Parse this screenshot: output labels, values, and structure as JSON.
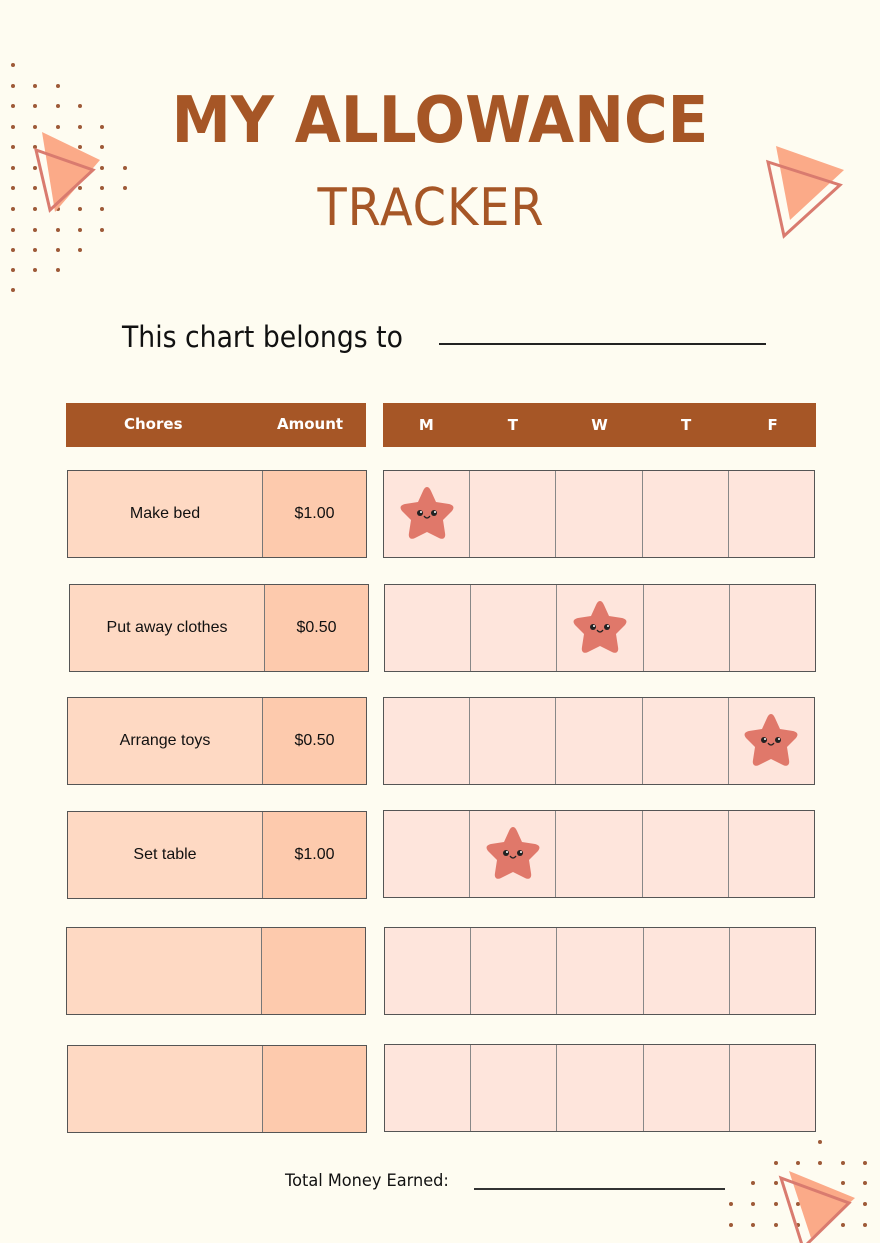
{
  "title": {
    "line1": "MY ALLOWANCE",
    "line2": "TRACKER"
  },
  "owner": {
    "label": "This chart belongs to",
    "value": ""
  },
  "table": {
    "headers": {
      "chores": "Chores",
      "amount": "Amount",
      "days": [
        "M",
        "T",
        "W",
        "T",
        "F"
      ]
    },
    "rows": [
      {
        "chore": "Make bed",
        "amount": "$1.00",
        "stars": [
          true,
          false,
          false,
          false,
          false
        ]
      },
      {
        "chore": "Put away clothes",
        "amount": "$0.50",
        "stars": [
          false,
          false,
          true,
          false,
          false
        ]
      },
      {
        "chore": "Arrange toys",
        "amount": "$0.50",
        "stars": [
          false,
          false,
          false,
          false,
          true
        ]
      },
      {
        "chore": "Set table",
        "amount": "$1.00",
        "stars": [
          false,
          true,
          false,
          false,
          false
        ]
      },
      {
        "chore": "",
        "amount": "",
        "stars": [
          false,
          false,
          false,
          false,
          false
        ]
      },
      {
        "chore": "",
        "amount": "",
        "stars": [
          false,
          false,
          false,
          false,
          false
        ]
      }
    ]
  },
  "total": {
    "label": "Total Money Earned:",
    "value": ""
  },
  "icons": {
    "star": "smiling-star-icon",
    "triangle": "triangle-decoration"
  },
  "colors": {
    "brand": "#a65626",
    "background": "#fefcf1",
    "chore_cell": "#fed9c3",
    "amount_cell": "#fdcaad",
    "day_cell": "#fee5dc",
    "star": "#e0786a",
    "triangle_fill": "#fbaa88",
    "triangle_outline": "#d97b6f"
  }
}
